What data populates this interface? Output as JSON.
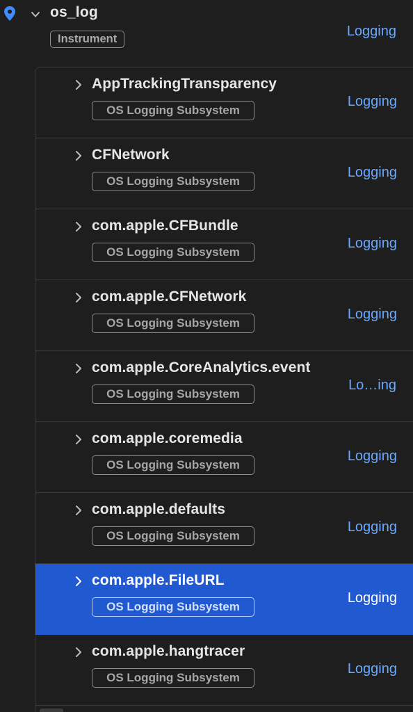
{
  "instrument": {
    "name": "os_log",
    "badge": "Instrument",
    "link": "Logging"
  },
  "subsystems": [
    {
      "name": "AppTrackingTransparency",
      "badge": "OS Logging Subsystem",
      "link": "Logging",
      "selected": false
    },
    {
      "name": "CFNetwork",
      "badge": "OS Logging Subsystem",
      "link": "Logging",
      "selected": false
    },
    {
      "name": "com.apple.CFBundle",
      "badge": "OS Logging Subsystem",
      "link": "Logging",
      "selected": false
    },
    {
      "name": "com.apple.CFNetwork",
      "badge": "OS Logging Subsystem",
      "link": "Logging",
      "selected": false
    },
    {
      "name": "com.apple.CoreAnalytics.event",
      "badge": "OS Logging Subsystem",
      "link": "Lo…ing",
      "selected": false
    },
    {
      "name": "com.apple.coremedia",
      "badge": "OS Logging Subsystem",
      "link": "Logging",
      "selected": false
    },
    {
      "name": "com.apple.defaults",
      "badge": "OS Logging Subsystem",
      "link": "Logging",
      "selected": false
    },
    {
      "name": "com.apple.FileURL",
      "badge": "OS Logging Subsystem",
      "link": "Logging",
      "selected": true
    },
    {
      "name": "com.apple.hangtracer",
      "badge": "OS Logging Subsystem",
      "link": "Logging",
      "selected": false
    }
  ],
  "colors": {
    "background": "#1e1e1e",
    "accent_link": "#6aa9ff",
    "selection": "#2159d1",
    "pin": "#3f8cff"
  },
  "icons": {
    "pin": "location-pin-icon",
    "expanded": "chevron-down-icon",
    "collapsed": "chevron-right-icon"
  }
}
